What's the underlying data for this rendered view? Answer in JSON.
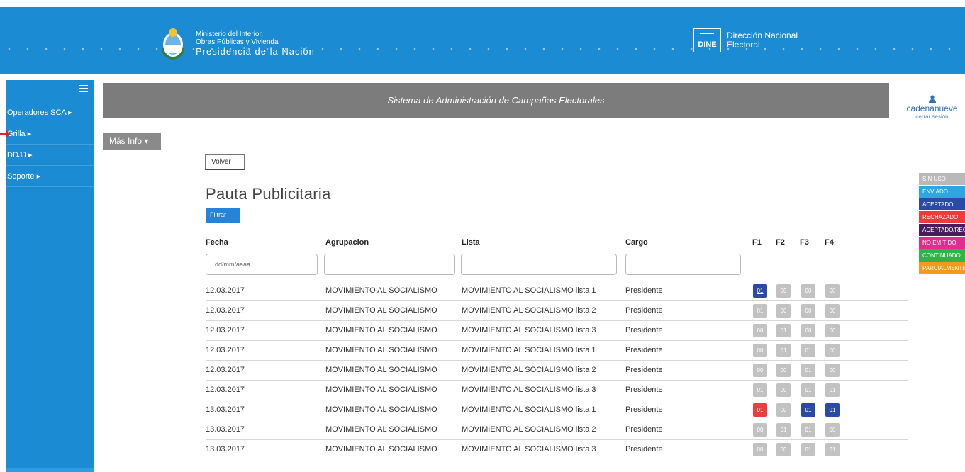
{
  "header": {
    "ministry_line1": "Ministerio del Interior,",
    "ministry_line2": "Obras Públicas y Vivienda",
    "ministry_line3": "Presidencia de la Nación",
    "dine_logo": "DINE",
    "dine_line1": "Dirección Nacional",
    "dine_line2": "Electoral"
  },
  "sidebar": {
    "items": [
      {
        "label": "Operadores SCA ▸"
      },
      {
        "label": "Grilla ▸"
      },
      {
        "label": "DDJJ ▸"
      },
      {
        "label": "Soporte ▸"
      }
    ]
  },
  "banner": {
    "title": "Sistema de Administración de Campañas Electorales"
  },
  "user": {
    "name": "cadenanueve",
    "logout": "cerrar sesión"
  },
  "toolbar": {
    "mas_info": "Más Info ▾",
    "volver": "Volver",
    "filtrar": "Filtrar"
  },
  "page": {
    "title": "Pauta Publicitaria"
  },
  "table": {
    "headers": {
      "fecha": "Fecha",
      "agrupacion": "Agrupacion",
      "lista": "Lista",
      "cargo": "Cargo",
      "f1": "F1",
      "f2": "F2",
      "f3": "F3",
      "f4": "F4"
    },
    "fecha_placeholder": "dd/mm/aaaa",
    "rows": [
      {
        "fecha": "12.03.2017",
        "agrupacion": "MOVIMIENTO AL SOCIALISMO",
        "lista": "MOVIMIENTO AL SOCIALISMO lista 1",
        "cargo": "Presidente",
        "f": [
          "01",
          "00",
          "00",
          "00"
        ],
        "s": [
          "b",
          "g",
          "g",
          "g"
        ]
      },
      {
        "fecha": "12.03.2017",
        "agrupacion": "MOVIMIENTO AL SOCIALISMO",
        "lista": "MOVIMIENTO AL SOCIALISMO lista 2",
        "cargo": "Presidente",
        "f": [
          "01",
          "00",
          "00",
          "00"
        ],
        "s": [
          "g",
          "g",
          "g",
          "g"
        ]
      },
      {
        "fecha": "12.03.2017",
        "agrupacion": "MOVIMIENTO AL SOCIALISMO",
        "lista": "MOVIMIENTO AL SOCIALISMO lista 3",
        "cargo": "Presidente",
        "f": [
          "00",
          "01",
          "00",
          "00"
        ],
        "s": [
          "g",
          "g",
          "g",
          "g"
        ]
      },
      {
        "fecha": "12.03.2017",
        "agrupacion": "MOVIMIENTO AL SOCIALISMO",
        "lista": "MOVIMIENTO AL SOCIALISMO lista 1",
        "cargo": "Presidente",
        "f": [
          "00",
          "01",
          "01",
          "00"
        ],
        "s": [
          "g",
          "g",
          "g",
          "g"
        ]
      },
      {
        "fecha": "12.03.2017",
        "agrupacion": "MOVIMIENTO AL SOCIALISMO",
        "lista": "MOVIMIENTO AL SOCIALISMO lista 2",
        "cargo": "Presidente",
        "f": [
          "00",
          "00",
          "01",
          "00"
        ],
        "s": [
          "g",
          "g",
          "g",
          "g"
        ]
      },
      {
        "fecha": "12.03.2017",
        "agrupacion": "MOVIMIENTO AL SOCIALISMO",
        "lista": "MOVIMIENTO AL SOCIALISMO lista 3",
        "cargo": "Presidente",
        "f": [
          "01",
          "00",
          "01",
          "01"
        ],
        "s": [
          "g",
          "g",
          "g",
          "g"
        ]
      },
      {
        "fecha": "13.03.2017",
        "agrupacion": "MOVIMIENTO AL SOCIALISMO",
        "lista": "MOVIMIENTO AL SOCIALISMO lista 1",
        "cargo": "Presidente",
        "f": [
          "01",
          "00",
          "01",
          "01"
        ],
        "s": [
          "r",
          "g",
          "b",
          "b"
        ]
      },
      {
        "fecha": "13.03.2017",
        "agrupacion": "MOVIMIENTO AL SOCIALISMO",
        "lista": "MOVIMIENTO AL SOCIALISMO lista 2",
        "cargo": "Presidente",
        "f": [
          "00",
          "01",
          "01",
          "00"
        ],
        "s": [
          "g",
          "g",
          "g",
          "g"
        ]
      },
      {
        "fecha": "13.03.2017",
        "agrupacion": "MOVIMIENTO AL SOCIALISMO",
        "lista": "MOVIMIENTO AL SOCIALISMO lista 3",
        "cargo": "Presidente",
        "f": [
          "00",
          "00",
          "01",
          "01"
        ],
        "s": [
          "g",
          "g",
          "g",
          "g"
        ]
      }
    ]
  },
  "legend": [
    {
      "label": "SIN USO",
      "color": "#b9b9b9"
    },
    {
      "label": "ENVIADO",
      "color": "#2ca7e0"
    },
    {
      "label": "ACEPTADO",
      "color": "#2b4aa8"
    },
    {
      "label": "RECHAZADO",
      "color": "#ee3b3b"
    },
    {
      "label": "ACEPTADO/REC",
      "color": "#4a1b5e"
    },
    {
      "label": "NO EMITIDO",
      "color": "#e22c8f"
    },
    {
      "label": "CONTINUADO",
      "color": "#2fb34a"
    },
    {
      "label": "PARCIALMENTE",
      "color": "#f39a1e"
    }
  ],
  "colors": {
    "primary": "#1b8cd4",
    "badge_blue": "#2b4aa8",
    "badge_gray": "#c2c2c2",
    "badge_red": "#ee3b3b"
  }
}
